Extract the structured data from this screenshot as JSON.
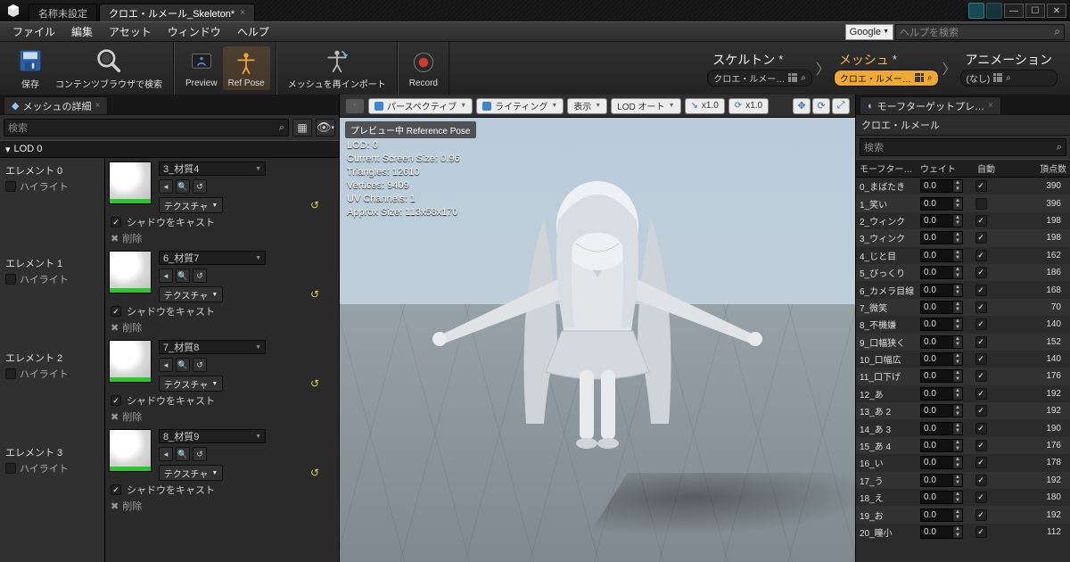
{
  "titlebar": {
    "tabs": [
      {
        "label": "名称未設定"
      },
      {
        "label": "クロエ・ルメール_Skeleton*"
      }
    ]
  },
  "menu": {
    "items": [
      "ファイル",
      "編集",
      "アセット",
      "ウィンドウ",
      "ヘルプ"
    ],
    "google": "Google",
    "help_search_placeholder": "ヘルプを検索"
  },
  "toolbar": {
    "save": "保存",
    "content_browser": "コンテンツブラウザで検索",
    "preview": "Preview",
    "refpose": "Ref Pose",
    "reimport": "メッシュを再インポート",
    "record": "Record"
  },
  "modes": {
    "skeleton_top": "スケルトン",
    "skeleton_chip": "クロエ・ルメー…",
    "mesh_top": "メッシュ",
    "mesh_chip": "クロエ・ルメー…",
    "anim_top": "アニメーション",
    "anim_chip": "(なし)"
  },
  "details": {
    "tab": "メッシュの詳細",
    "search_placeholder": "検索",
    "lod_header": "LOD 0",
    "element_label_prefix": "エレメント",
    "highlight_label": "ハイライト",
    "shadow_label": "シャドウをキャスト",
    "delete_label": "削除",
    "texture_btn": "テクスチャ",
    "materials": [
      {
        "element_index": 0,
        "name": "3_材質4"
      },
      {
        "element_index": 1,
        "name": "6_材質7"
      },
      {
        "element_index": 2,
        "name": "7_材質8"
      },
      {
        "element_index": 3,
        "name": "8_材質9"
      }
    ]
  },
  "viewport": {
    "banner": "プレビュー中 Reference Pose",
    "pills": {
      "menu": "▾",
      "perspective": "パースペクティブ",
      "lighting": "ライティング",
      "show": "表示",
      "lod": "LOD オート",
      "speed1": "x1.0",
      "speed2": "x1.0"
    },
    "stats": {
      "l1": "LOD: 0",
      "l2": "Current Screen Size: 0.96",
      "l3": "Triangles: 12610",
      "l4": "Vertices: 9409",
      "l5": "UV Channels: 1",
      "l6": "Approx Size: 113x58x170"
    }
  },
  "morph": {
    "tab": "モーフターゲットプレ…",
    "asset_name": "クロエ・ルメール",
    "search_placeholder": "検索",
    "cols": {
      "name": "モーフター…",
      "weight": "ウェイト",
      "auto": "自動",
      "verts": "頂点数"
    },
    "rows": [
      {
        "name": "0_まばたき",
        "weight": "0.0",
        "auto": true,
        "verts": 390
      },
      {
        "name": "1_笑い",
        "weight": "0.0",
        "auto": false,
        "verts": 396
      },
      {
        "name": "2_ウィンク",
        "weight": "0.0",
        "auto": true,
        "verts": 198
      },
      {
        "name": "3_ウィンク",
        "weight": "0.0",
        "auto": true,
        "verts": 198
      },
      {
        "name": "4_じと目",
        "weight": "0.0",
        "auto": true,
        "verts": 162
      },
      {
        "name": "5_びっくり",
        "weight": "0.0",
        "auto": true,
        "verts": 186
      },
      {
        "name": "6_カメラ目線",
        "weight": "0.0",
        "auto": true,
        "verts": 168
      },
      {
        "name": "7_微笑",
        "weight": "0.0",
        "auto": true,
        "verts": 70
      },
      {
        "name": "8_不機嫌",
        "weight": "0.0",
        "auto": true,
        "verts": 140
      },
      {
        "name": "9_口幅狭く",
        "weight": "0.0",
        "auto": true,
        "verts": 152
      },
      {
        "name": "10_口幅広",
        "weight": "0.0",
        "auto": true,
        "verts": 140
      },
      {
        "name": "11_口下げ",
        "weight": "0.0",
        "auto": true,
        "verts": 176
      },
      {
        "name": "12_あ",
        "weight": "0.0",
        "auto": true,
        "verts": 192
      },
      {
        "name": "13_あ 2",
        "weight": "0.0",
        "auto": true,
        "verts": 192
      },
      {
        "name": "14_あ 3",
        "weight": "0.0",
        "auto": true,
        "verts": 190
      },
      {
        "name": "15_あ 4",
        "weight": "0.0",
        "auto": true,
        "verts": 176
      },
      {
        "name": "16_い",
        "weight": "0.0",
        "auto": true,
        "verts": 178
      },
      {
        "name": "17_う",
        "weight": "0.0",
        "auto": true,
        "verts": 192
      },
      {
        "name": "18_え",
        "weight": "0.0",
        "auto": true,
        "verts": 180
      },
      {
        "name": "19_お",
        "weight": "0.0",
        "auto": true,
        "verts": 192
      },
      {
        "name": "20_瞳小",
        "weight": "0.0",
        "auto": true,
        "verts": 112
      }
    ]
  }
}
